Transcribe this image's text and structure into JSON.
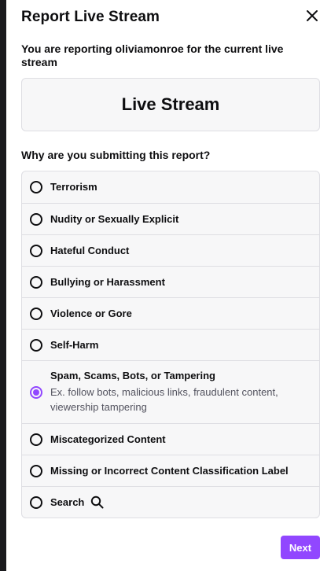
{
  "dialog": {
    "title": "Report Live Stream",
    "close_icon": "close-icon",
    "subtitle": "You are reporting oliviamonroe for the current live stream",
    "target_label": "Live Stream",
    "question": "Why are you submitting this report?",
    "reasons": [
      {
        "label": "Terrorism",
        "checked": false
      },
      {
        "label": "Nudity or Sexually Explicit",
        "checked": false
      },
      {
        "label": "Hateful Conduct",
        "checked": false
      },
      {
        "label": "Bullying or Harassment",
        "checked": false
      },
      {
        "label": "Violence or Gore",
        "checked": false
      },
      {
        "label": "Self-Harm",
        "checked": false
      },
      {
        "label": "Spam, Scams, Bots, or Tampering",
        "description": "Ex. follow bots, malicious links, fraudulent content, viewership tampering",
        "checked": true
      },
      {
        "label": "Miscategorized Content",
        "checked": false
      },
      {
        "label": "Missing or Incorrect Content Classification Label",
        "checked": false
      },
      {
        "label": "Search",
        "icon": "search-icon",
        "checked": false
      }
    ],
    "next_label": "Next",
    "accent_color": "#9147ff"
  }
}
